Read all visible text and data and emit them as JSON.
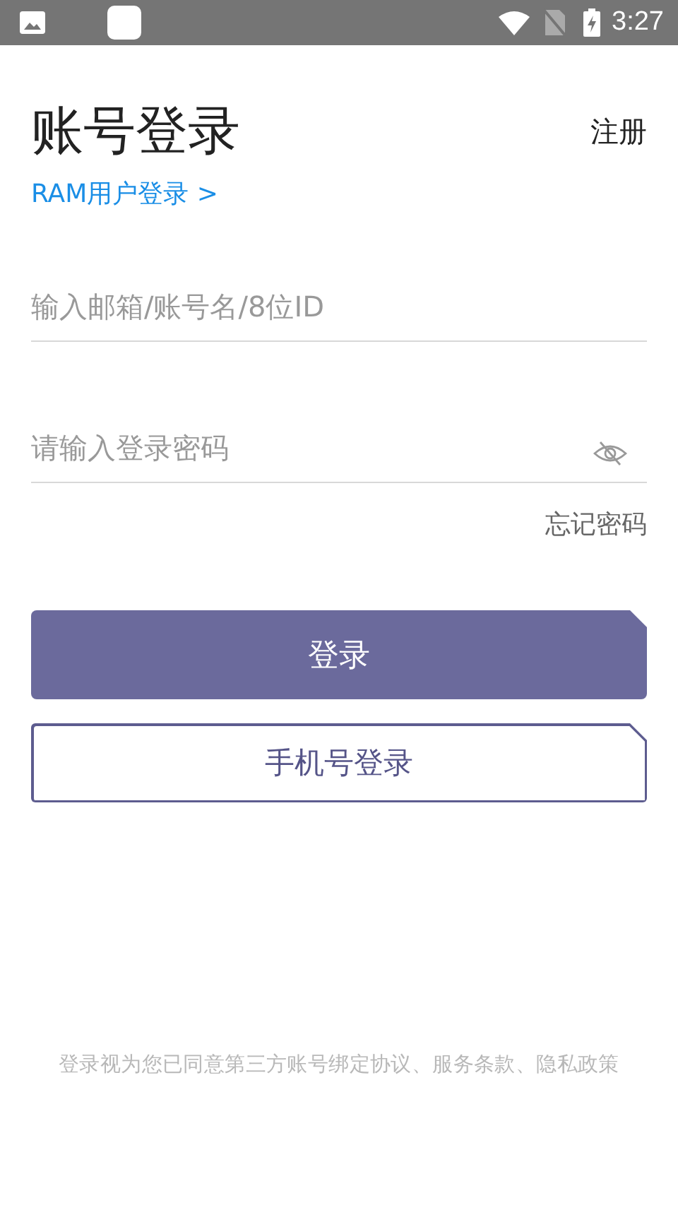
{
  "status_bar": {
    "time": "3:27"
  },
  "header": {
    "title": "账号登录",
    "register": "注册",
    "ram_link": "RAM用户登录 >"
  },
  "account_field": {
    "placeholder": "输入邮箱/账号名/8位ID"
  },
  "password_field": {
    "placeholder": "请输入登录密码",
    "password_visible": false
  },
  "forgot_link": "忘记密码",
  "buttons": [
    {
      "kind": "filled",
      "label": "登录"
    },
    {
      "kind": "outline",
      "label": "手机号登录"
    }
  ],
  "terms": "登录视为您已同意第三方账号绑定协议、服务条款、隐私政策"
}
